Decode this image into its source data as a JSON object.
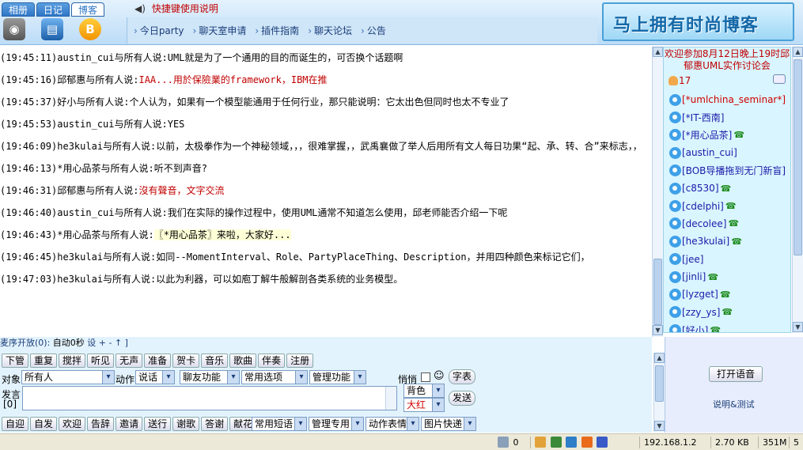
{
  "header": {
    "tabs": [
      "相册",
      "日记",
      "博客"
    ],
    "active_tab": "博客",
    "hotkey_text": "快捷键使用说明",
    "links": [
      "今日party",
      "聊天室申请",
      "插件指南",
      "聊天论坛",
      "公告"
    ],
    "banner_text": "马上拥有时尚博客"
  },
  "chat": {
    "messages": [
      {
        "time": "(19:45:11)",
        "who": "austin_cui与所有人说:",
        "text": "UML就是为了一个通用的目的而诞生的，可否换个话题啊",
        "style": "normal"
      },
      {
        "time": "(19:45:16)",
        "who": "邱郁惠与所有人说:",
        "text": "IAA...用於保險業的framework，IBM在推",
        "style": "red"
      },
      {
        "time": "(19:45:37)",
        "who": "好小与所有人说:",
        "text": "个人认为，如果有一个模型能通用于任何行业，那只能说明：它太出色但同时也太不专业了",
        "style": "normal"
      },
      {
        "time": "(19:45:53)",
        "who": "austin_cui与所有人说:",
        "text": "YES",
        "style": "normal"
      },
      {
        "time": "(19:46:09)",
        "who": "he3kulai与所有人说:",
        "text": "以前，太极拳作为一个神秘领域，，，很难掌握，，武禹襄做了举人后用所有文人每日功果“起、承、转、合”来标志，，",
        "style": "wrap"
      },
      {
        "time": "(19:46:13)",
        "who": "*用心品茶与所有人说:",
        "text": "听不到声音?",
        "style": "normal"
      },
      {
        "time": "(19:46:31)",
        "who": "邱郁惠与所有人说:",
        "text": "沒有聲音，文字交流",
        "style": "red"
      },
      {
        "time": "(19:46:40)",
        "who": "austin_cui与所有人说:",
        "text": "我们在实际的操作过程中，使用UML通常不知道怎么使用，邱老师能否介绍一下呢",
        "style": "normal"
      },
      {
        "time": "(19:46:43)",
        "who": "*用心品茶与所有人说:",
        "text": "〖*用心品茶〗来啦，大家好...",
        "style": "hl"
      },
      {
        "time": "(19:46:45)",
        "who": "he3kulai与所有人说:",
        "text": "如同--MomentInterval、Role、PartyPlaceThing、Description，并用四种颜色来标记它们，",
        "style": "wrap"
      },
      {
        "time": "(19:47:03)",
        "who": "he3kulai与所有人说:",
        "text": "以此为利器，可以如庖丁解牛般解剖各类系统的业务模型。",
        "style": "normal"
      }
    ]
  },
  "users": {
    "notice": "欢迎参加8月12日晚上19时邱郁惠UML实作讨论会",
    "count": "17",
    "list": [
      {
        "name": "[*umlchina_seminar*]",
        "red": true,
        "phone": false
      },
      {
        "name": "[*IT-西南]",
        "red": false,
        "phone": false
      },
      {
        "name": "[*用心品茶]",
        "red": false,
        "phone": true
      },
      {
        "name": "[austin_cui]",
        "red": false,
        "phone": false
      },
      {
        "name": "[BOB导播拖到无门新盲]",
        "red": false,
        "phone": false
      },
      {
        "name": "[c8530]",
        "red": false,
        "phone": true
      },
      {
        "name": "[cdelphi]",
        "red": false,
        "phone": true
      },
      {
        "name": "[decolee]",
        "red": false,
        "phone": true
      },
      {
        "name": "[he3kulai]",
        "red": false,
        "phone": true
      },
      {
        "name": "[jee]",
        "red": false,
        "phone": false
      },
      {
        "name": "[jinli]",
        "red": false,
        "phone": true
      },
      {
        "name": "[lyzget]",
        "red": false,
        "phone": true
      },
      {
        "name": "[zzy_ys]",
        "red": false,
        "phone": true
      },
      {
        "name": "[好小]",
        "red": false,
        "phone": true
      }
    ]
  },
  "controls": {
    "mic_status": "麦序开放(0):",
    "auto_time": "自动0秒",
    "settings": "设 + - ↑ ]",
    "row1": [
      "下管",
      "重复",
      "搅拌",
      "听见",
      "无声",
      "准备",
      "贺卡",
      "音乐",
      "歌曲",
      "伴奏",
      "注册"
    ],
    "target_label": "对象",
    "target_value": "所有人",
    "action_label": "动作",
    "action_value": "说话",
    "friend_func": "聊友功能",
    "common_options": "常用选项",
    "manage_func": "管理功能",
    "whisper_label": "悄悄",
    "smiley": "☺",
    "express_button": "字表",
    "speak_label": "发言",
    "speak_count": "[0]",
    "bg_label": "背色",
    "color_value": "大红",
    "send_button": "发送",
    "row3": [
      "自迎",
      "自发",
      "欢迎",
      "告辞",
      "邀请",
      "送行",
      "谢歌",
      "答谢",
      "献花"
    ],
    "common_phrases": "常用短语",
    "manage_special": "管理专用",
    "action_emote": "动作表情",
    "image_fast": "图片快递",
    "voice_button": "打开语音",
    "help_link": "说明&测试"
  },
  "statusbar": {
    "zero": "0",
    "ip": "192.168.1.2",
    "kb": "2.70 KB",
    "mem": "351M",
    "page": "5"
  }
}
